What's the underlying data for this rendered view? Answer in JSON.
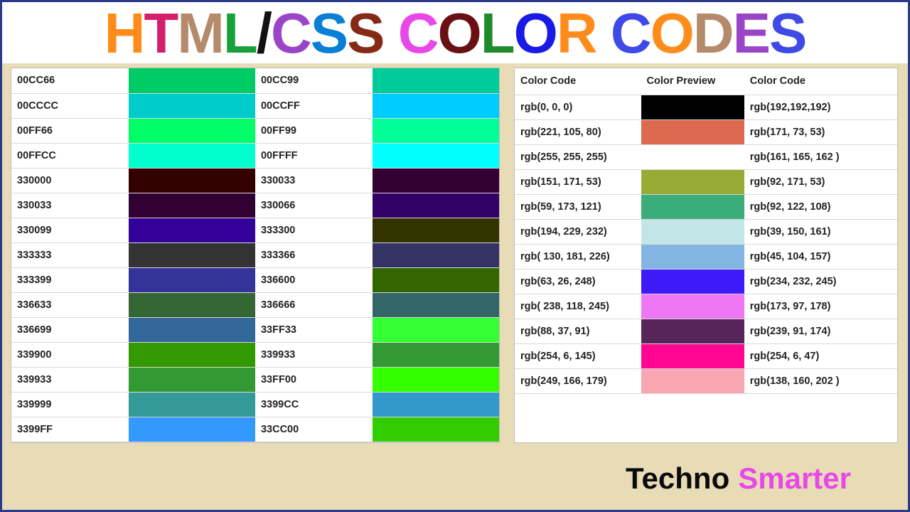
{
  "title_letters": [
    {
      "ch": "H",
      "c": "#ff8c1a"
    },
    {
      "ch": "T",
      "c": "#d61f6a"
    },
    {
      "ch": "M",
      "c": "#b58a6b"
    },
    {
      "ch": "L",
      "c": "#18a03b"
    },
    {
      "ch": "/",
      "c": "#111"
    },
    {
      "ch": "C",
      "c": "#9a44c7"
    },
    {
      "ch": "S",
      "c": "#0a7fd6"
    },
    {
      "ch": "S",
      "c": "#862a18"
    },
    {
      "ch": " ",
      "c": "#000"
    },
    {
      "ch": "C",
      "c": "#e848e8"
    },
    {
      "ch": "O",
      "c": "#6a0f12"
    },
    {
      "ch": "L",
      "c": "#1f8a2a"
    },
    {
      "ch": "O",
      "c": "#1a1ae6"
    },
    {
      "ch": "R",
      "c": "#ff8c1a"
    },
    {
      "ch": " ",
      "c": "#000"
    },
    {
      "ch": "C",
      "c": "#3f4ae6"
    },
    {
      "ch": "O",
      "c": "#ff8c1a"
    },
    {
      "ch": "D",
      "c": "#b58a6b"
    },
    {
      "ch": "E",
      "c": "#9a44c7"
    },
    {
      "ch": "S",
      "c": "#3f4ae6"
    }
  ],
  "hex_rows": [
    {
      "a": "00CC66",
      "b": "00CC99"
    },
    {
      "a": "00CCCC",
      "b": "00CCFF"
    },
    {
      "a": "00FF66",
      "b": "00FF99"
    },
    {
      "a": "00FFCC",
      "b": "00FFFF"
    },
    {
      "a": "330000",
      "b": "330033"
    },
    {
      "a": "330033",
      "b": "330066"
    },
    {
      "a": "330099",
      "b": "333300"
    },
    {
      "a": "333333",
      "b": "333366"
    },
    {
      "a": "333399",
      "b": "336600"
    },
    {
      "a": "336633",
      "b": "336666"
    },
    {
      "a": "336699",
      "b": "33FF33"
    },
    {
      "a": "339900",
      "b": "339933"
    },
    {
      "a": "339933",
      "b": "33FF00"
    },
    {
      "a": "339999",
      "b": "3399CC"
    },
    {
      "a": "3399FF",
      "b": "33CC00"
    }
  ],
  "rgb_header": {
    "c1": "Color Code",
    "c2": "Color Preview",
    "c3": "Color Code"
  },
  "rgb_rows": [
    {
      "code": "rgb(0, 0, 0)",
      "preview": "rgb(0,0,0)",
      "code2": "rgb(192,192,192)"
    },
    {
      "code": "rgb(221, 105, 80)",
      "preview": "rgb(221,105,80)",
      "code2": "rgb(171, 73, 53)"
    },
    {
      "code": "rgb(255, 255, 255)",
      "preview": "rgb(255,255,255)",
      "code2": "rgb(161, 165, 162 )"
    },
    {
      "code": "rgb(151, 171, 53)",
      "preview": "rgb(151,171,53)",
      "code2": "rgb(92, 171, 53)"
    },
    {
      "code": "rgb(59, 173, 121)",
      "preview": "rgb(59,173,121)",
      "code2": "rgb(92, 122, 108)"
    },
    {
      "code": "rgb(194, 229, 232)",
      "preview": "rgb(194,229,232)",
      "code2": "rgb(39, 150, 161)"
    },
    {
      "code": "rgb( 130, 181, 226)",
      "preview": "rgb(130,181,226)",
      "code2": "rgb(45, 104, 157)"
    },
    {
      "code": "rgb(63, 26, 248)",
      "preview": "rgb(63,26,248)",
      "code2": "rgb(234, 232, 245)"
    },
    {
      "code": "rgb( 238, 118, 245)",
      "preview": "rgb(238,118,245)",
      "code2": "rgb(173, 97, 178)"
    },
    {
      "code": "rgb(88, 37, 91)",
      "preview": "rgb(88,37,91)",
      "code2": "rgb(239, 91, 174)"
    },
    {
      "code": "rgb(254, 6, 145)",
      "preview": "rgb(254,6,145)",
      "code2": "rgb(254, 6, 47)"
    },
    {
      "code": "rgb(249, 166, 179)",
      "preview": "rgb(249,166,179)",
      "code2": "rgb(138, 160, 202 )"
    }
  ],
  "footer": {
    "a": "Techno",
    "b": "Smarter",
    "a_color": "#0a0a0a",
    "b_color": "#e848e8"
  }
}
